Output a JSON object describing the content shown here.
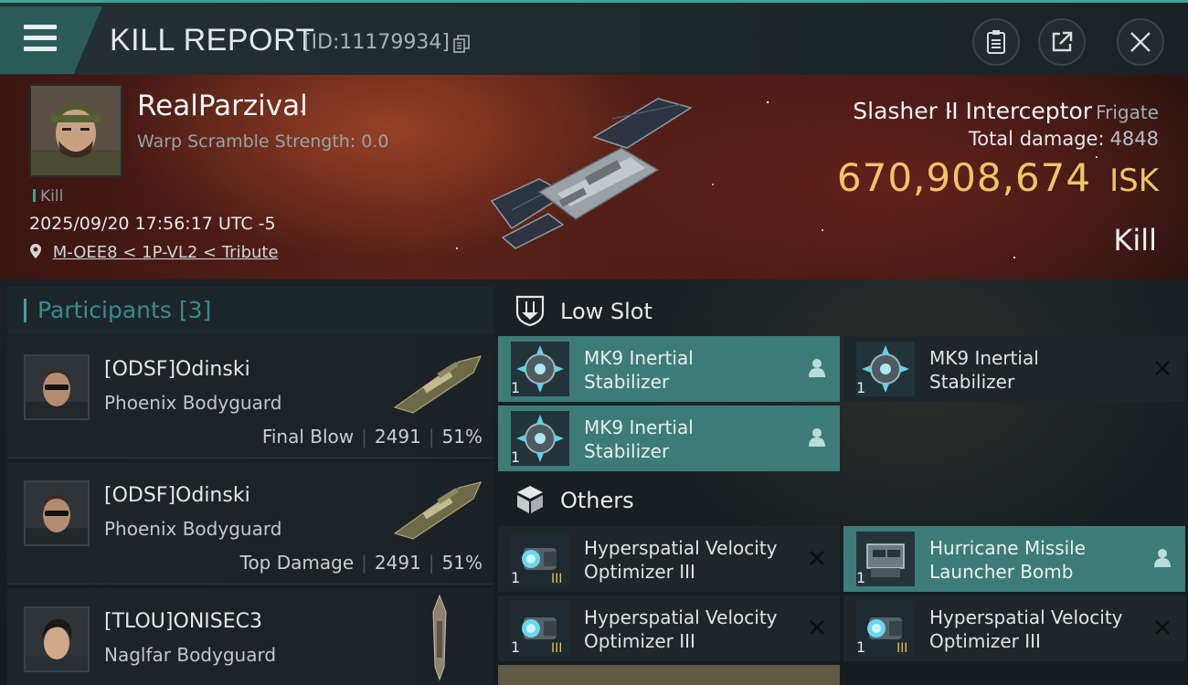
{
  "header": {
    "title": "KILL REPORT",
    "report_id": "[ID:11179934]"
  },
  "victim": {
    "name": "RealParzival",
    "warp_scramble": "Warp Scramble Strength: 0.0",
    "tag": "Kill",
    "timestamp": "2025/09/20 17:56:17 UTC -5",
    "location": "M-OEE8 < 1P-VL2 < Tribute",
    "ship_name": "Slasher II Interceptor",
    "ship_class": "Frigate",
    "total_damage_label": "Total damage:",
    "total_damage": "4848",
    "isk_value": "670,908,674",
    "isk_unit": "ISK",
    "result": "Kill"
  },
  "participants": {
    "label": "Participants",
    "count": "[3]",
    "rows": [
      {
        "name": "[ODSF]Odinski",
        "ship": "Phoenix Bodyguard",
        "role": "Final Blow",
        "damage": "2491",
        "percent": "51%"
      },
      {
        "name": "[ODSF]Odinski",
        "ship": "Phoenix Bodyguard",
        "role": "Top Damage",
        "damage": "2491",
        "percent": "51%"
      },
      {
        "name": "[TLOU]ONISEC3",
        "ship": "Naglfar Bodyguard",
        "role": "",
        "damage": "",
        "percent": ""
      }
    ]
  },
  "slots": {
    "low_slot": {
      "label": "Low Slot",
      "items": [
        {
          "qty": "1",
          "line1": "MK9 Inertial",
          "line2": "Stabilizer",
          "state": "dropped"
        },
        {
          "qty": "1",
          "line1": "MK9 Inertial",
          "line2": "Stabilizer",
          "state": "destroyed"
        },
        {
          "qty": "1",
          "line1": "MK9 Inertial",
          "line2": "Stabilizer",
          "state": "dropped"
        }
      ]
    },
    "others": {
      "label": "Others",
      "items": [
        {
          "qty": "1",
          "line1": "Hyperspatial Velocity",
          "line2": "Optimizer III",
          "state": "destroyed"
        },
        {
          "qty": "1",
          "line1": "Hurricane Missile",
          "line2": "Launcher Bomb",
          "state": "dropped"
        },
        {
          "qty": "1",
          "line1": "Hyperspatial Velocity",
          "line2": "Optimizer III",
          "state": "destroyed"
        },
        {
          "qty": "1",
          "line1": "Hyperspatial Velocity",
          "line2": "Optimizer III",
          "state": "destroyed"
        }
      ]
    }
  },
  "colors": {
    "accent": "#3fa39a",
    "dropped_highlight": "#3d7c76",
    "isk_gold": "#f2c46b"
  },
  "icons": [
    "menu-icon",
    "copy-icon",
    "clipboard-icon",
    "share-icon",
    "close-icon",
    "location-pin-icon",
    "low-slot-icon",
    "cube-icon",
    "person-icon",
    "x-mark-icon"
  ]
}
